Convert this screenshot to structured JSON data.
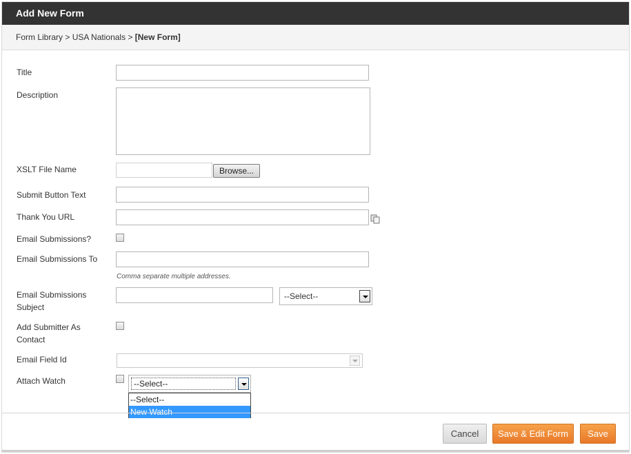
{
  "dialog": {
    "title": "Add New Form",
    "breadcrumb": {
      "part1": "Form Library",
      "sep1": " > ",
      "part2": "USA Nationals",
      "sep2": " > ",
      "current": "[New Form]"
    }
  },
  "form": {
    "title_label": "Title",
    "title_value": "",
    "description_label": "Description",
    "description_value": "",
    "xslt_label": "XSLT File Name",
    "xslt_value": "",
    "browse_label": "Browse...",
    "submit_text_label": "Submit Button Text",
    "submit_text_value": "",
    "thank_you_label": "Thank You URL",
    "thank_you_value": "",
    "email_submissions_label": "Email Submissions?",
    "email_submissions_checked": false,
    "email_to_label": "Email Submissions To",
    "email_to_value": "",
    "email_to_hint": "Comma separate multiple addresses.",
    "email_subject_label_line1": "Email Submissions",
    "email_subject_label_line2": "Subject",
    "email_subject_value": "",
    "email_subject_select": "--Select--",
    "add_submitter_label_line1": "Add Submitter As",
    "add_submitter_label_line2": "Contact",
    "add_submitter_checked": false,
    "email_field_id_label": "Email Field Id",
    "email_field_id_value": "",
    "attach_watch_label": "Attach Watch",
    "attach_watch_checked": false,
    "attach_watch_select": "--Select--",
    "attach_watch_options": [
      "--Select--",
      "New Watch"
    ],
    "attach_watch_highlighted": "New Watch"
  },
  "footer": {
    "cancel_label": "Cancel",
    "save_edit_label": "Save & Edit Form",
    "save_label": "Save"
  },
  "colors": {
    "titlebar": "#333333",
    "accent_orange": "#f0883a",
    "highlight": "#3399ff"
  },
  "icons": {
    "thank_you_url_picker": "copy-icon",
    "select_arrow": "chevron-down-icon"
  }
}
